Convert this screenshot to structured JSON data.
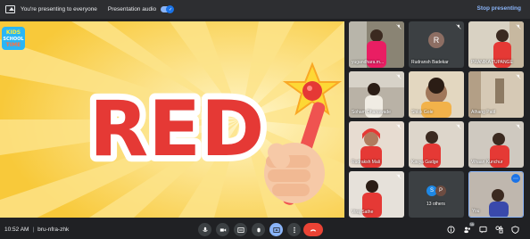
{
  "topbar": {
    "presenting_text": "You're presenting to everyone",
    "audio_label": "Presentation audio",
    "audio_check": "✓",
    "stop_label": "Stop presenting"
  },
  "slide": {
    "word": "RED",
    "logo_lines": [
      "KIDS",
      "SCHOOL",
      "TIME"
    ]
  },
  "participants": [
    {
      "name": "yugandhara.m..."
    },
    {
      "name": "Rudransh Badekar",
      "initial": "R"
    },
    {
      "name": "PRANIKA TUPANGE"
    },
    {
      "name": "Soham Dhanawade"
    },
    {
      "name": "Shlok Gole"
    },
    {
      "name": "Athang Patil"
    },
    {
      "name": "Rudraksh Mali"
    },
    {
      "name": "Kavya Gadge"
    },
    {
      "name": "Vihaan Kunchur"
    },
    {
      "name": "Viraj Sathe"
    },
    {
      "name": "13 others",
      "avatars": [
        "S",
        "P"
      ]
    },
    {
      "name": "You",
      "more": "⋯"
    }
  ],
  "bottombar": {
    "time": "10:52 AM",
    "separator": "|",
    "meeting_code": "bru-nfra-zhk",
    "people_count": "35"
  },
  "colors": {
    "accent": "#8ab4f8",
    "end_call": "#ea4335",
    "slide_bg": "#fbd64a",
    "word_fill": "#e53935"
  }
}
